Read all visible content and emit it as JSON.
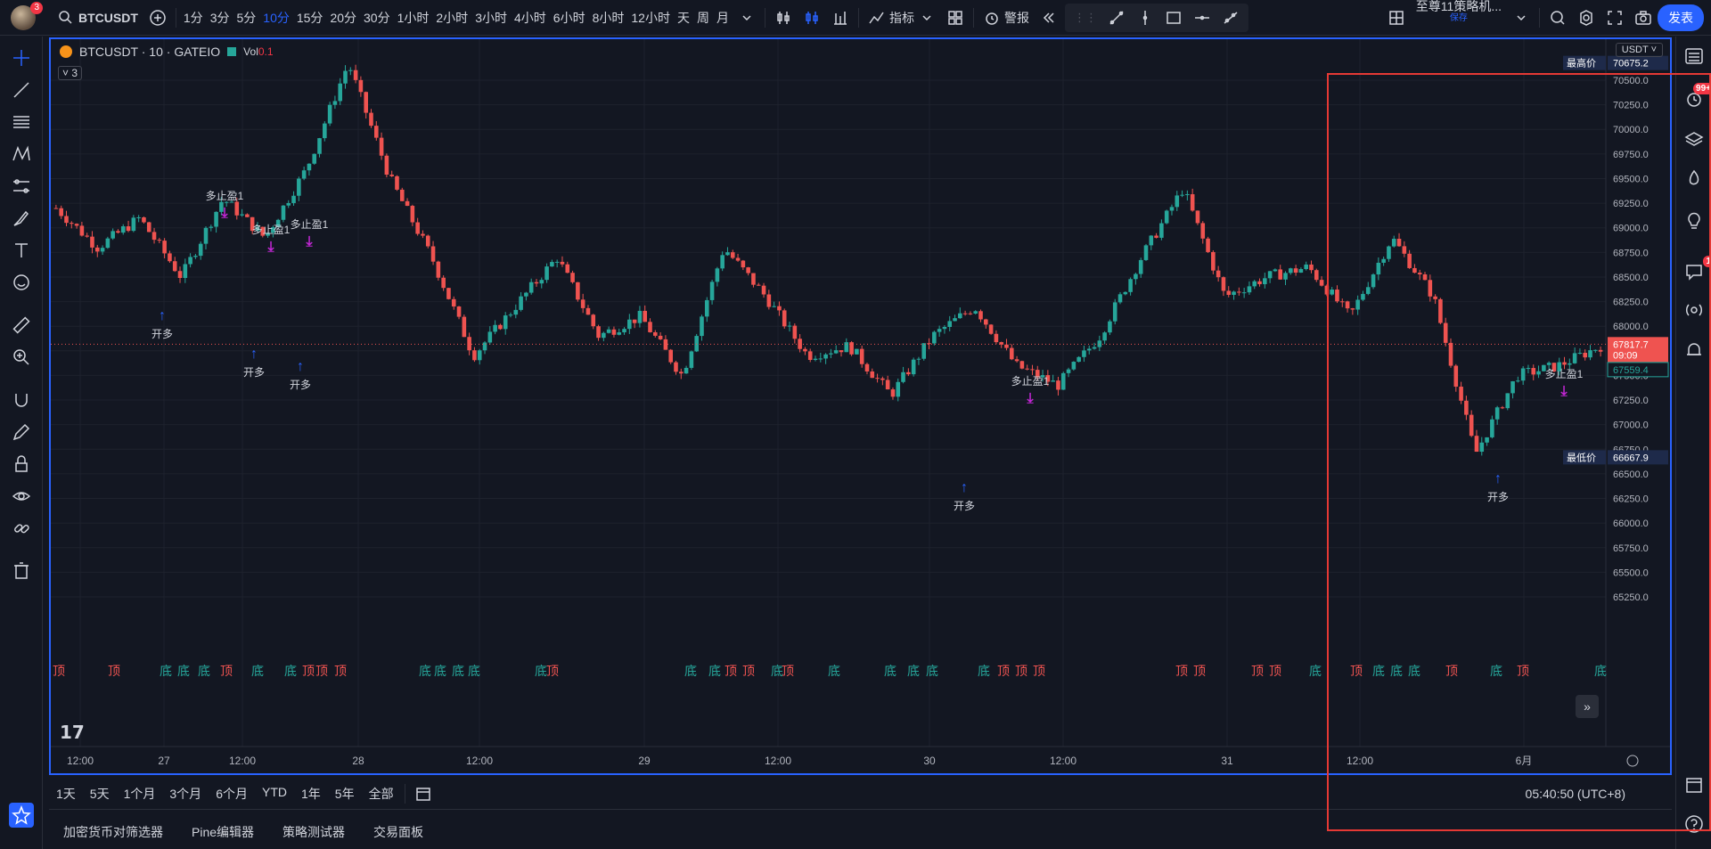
{
  "user": {
    "badge": "3"
  },
  "symbol_search": "BTCUSDT",
  "intervals": [
    "1分",
    "3分",
    "5分",
    "10分",
    "15分",
    "20分",
    "30分",
    "1小时",
    "2小时",
    "3小时",
    "4小时",
    "6小时",
    "8小时",
    "12小时",
    "天",
    "周",
    "月"
  ],
  "active_interval": "10分",
  "toolbar": {
    "indicators": "指标",
    "alert": "警报",
    "strategy_name": "至尊11策略机...",
    "strategy_sub": "保存",
    "publish": "发表"
  },
  "chart": {
    "legend_title": "BTCUSDT · 10 · GATEIO",
    "vol_label": "Vol",
    "vol_value": "0.1",
    "collapse_count": "3",
    "currency": "USDT",
    "y_ticks": [
      "70500.0",
      "70250.0",
      "70000.0",
      "69750.0",
      "69500.0",
      "69250.0",
      "69000.0",
      "68750.0",
      "68500.0",
      "68250.0",
      "68000.0",
      "67750.0",
      "67500.0",
      "67250.0",
      "67000.0",
      "66750.0",
      "66500.0",
      "66250.0",
      "66000.0",
      "65750.0",
      "65500.0",
      "65250.0"
    ],
    "x_ticks": [
      "12:00",
      "27",
      "12:00",
      "28",
      "12:00",
      "29",
      "12:00",
      "30",
      "12:00",
      "31",
      "12:00",
      "6月"
    ],
    "high_label": "最高价",
    "high_value": "70675.2",
    "low_label": "最低价",
    "low_value": "66667.9",
    "last_price": "67817.7",
    "countdown": "09:09",
    "secondary_price": "67559.4",
    "signals": {
      "take_profit": "多止盈1",
      "open_long": "开多",
      "top": "顶",
      "bottom": "底"
    },
    "colors": {
      "up": "#26a69a",
      "down": "#ef5350",
      "accent": "#2962ff",
      "signal": "#c026d3"
    }
  },
  "chart_data": {
    "type": "line",
    "title": "BTCUSDT · 10 · GATEIO",
    "xlabel": "",
    "ylabel": "",
    "ylim": [
      65100,
      70800
    ],
    "x": [
      "12:00",
      "27",
      "12:00",
      "28",
      "12:00",
      "29",
      "12:00",
      "30",
      "12:00",
      "31",
      "12:00",
      "6月"
    ],
    "series": [
      {
        "values": [
          69200,
          68800,
          69100,
          68500,
          69300,
          68900,
          69600,
          70675,
          69500,
          68700,
          67700,
          68200,
          68700,
          67900,
          68100,
          67500,
          68800,
          68300,
          67700,
          67800,
          67300,
          67900,
          68200,
          67600,
          67400,
          67900,
          68700,
          69400,
          68300,
          68500,
          68600,
          68100,
          68900,
          68300,
          66700,
          67500,
          67600,
          67800
        ]
      }
    ]
  },
  "range_buttons": [
    "1天",
    "5天",
    "1个月",
    "3个月",
    "6个月",
    "YTD",
    "1年",
    "5年",
    "全部"
  ],
  "clock": "05:40:50 (UTC+8)",
  "panel_tabs": [
    "加密货币对筛选器",
    "Pine编辑器",
    "策略测试器",
    "交易面板"
  ],
  "right_badges": {
    "notifications": "99+",
    "chat": "1"
  }
}
